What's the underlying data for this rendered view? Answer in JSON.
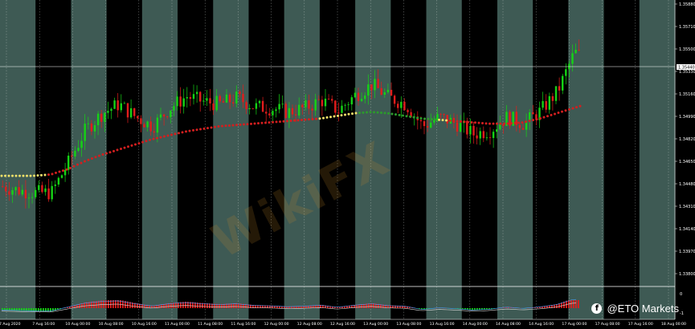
{
  "chart_data": {
    "type": "line",
    "symbol_note": "",
    "title": "",
    "y_ticks": [
      "1.35880",
      "1.35710",
      "1.35500",
      "1.35330",
      "1.35160",
      "1.34990",
      "1.34820",
      "1.34650",
      "1.34480",
      "1.34310",
      "1.34140",
      "1.33970",
      "1.33800"
    ],
    "current_price_label": "1.35440",
    "x_ticks": [
      "7 Aug 2020",
      "7 Aug 16:00",
      "10 Aug 00:00",
      "10 Aug 08:00",
      "10 Aug 16:00",
      "11 Aug 00:00",
      "11 Aug 08:00",
      "11 Aug 16:00",
      "12 Aug 00:00",
      "12 Aug 08:00",
      "12 Aug 16:00",
      "13 Aug 00:00",
      "13 Aug 08:00",
      "13 Aug 16:00",
      "14 Aug 00:00",
      "14 Aug 08:00",
      "14 Aug 16:00",
      "17 Aug 00:00",
      "17 Aug 08:00",
      "17 Aug 16:00",
      "18 Aug 00:00"
    ],
    "ylim": [
      1.3375,
      1.3595
    ],
    "sub_ticks": [
      "0",
      "-1"
    ],
    "series": [
      {
        "values": [
          1.3452,
          1.3449,
          1.3447,
          1.3447,
          1.347,
          1.3495,
          1.3508,
          1.3515,
          1.3505,
          1.3498,
          1.3512,
          1.3521,
          1.3517,
          1.3515,
          1.352,
          1.3513,
          1.3512,
          1.3509,
          1.3512,
          1.3518,
          1.351,
          1.3522,
          1.353,
          1.352,
          1.3515,
          1.3498,
          1.3505,
          1.35,
          1.3492,
          1.3495,
          1.3505,
          1.35,
          1.351,
          1.3525,
          1.3555,
          1.3548,
          1.356,
          1.357,
          1.3562,
          1.3566,
          1.3545
        ]
      },
      {
        "values": [
          1.346,
          1.346,
          1.346,
          1.3461,
          1.3465,
          1.3471,
          1.3476,
          1.348,
          1.3484,
          1.3488,
          1.3491,
          1.3494,
          1.3496,
          1.3498,
          1.3499,
          1.35,
          1.3501,
          1.3502,
          1.3503,
          1.3504,
          1.3506,
          1.3508,
          1.3509,
          1.3508,
          1.3506,
          1.3504,
          1.3503,
          1.3502,
          1.3501,
          1.35,
          1.35,
          1.3501,
          1.3504,
          1.3508,
          1.3512,
          1.3516,
          1.352,
          1.3524,
          1.3527,
          1.353,
          1.3533
        ]
      }
    ]
  },
  "colors": {
    "band_light": "#3e5a54",
    "band_dark": "#000000",
    "bull": "#15d315",
    "bear": "#e21c1c",
    "ma_red": "#d21f1f",
    "ma_yellow": "#f0e06a",
    "ma_green": "#2c9a2c",
    "grid": "#cfd8d4"
  },
  "branding": {
    "brand_text": "@ETO Markets",
    "facebook_icon": "f",
    "watermark_text": "WikiFX"
  }
}
